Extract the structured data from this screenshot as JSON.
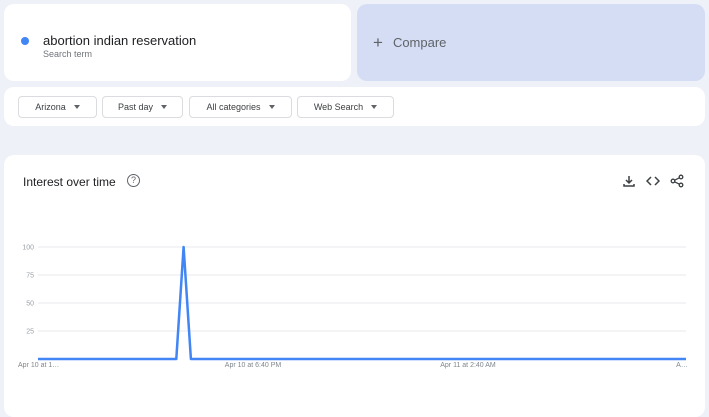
{
  "search_term": {
    "name": "abortion indian reservation",
    "subtitle": "Search term",
    "color": "#4285f4"
  },
  "compare": {
    "icon": "plus-icon",
    "label": "Compare"
  },
  "filters": [
    {
      "label": "Arizona"
    },
    {
      "label": "Past day"
    },
    {
      "label": "All categories"
    },
    {
      "label": "Web Search"
    }
  ],
  "card": {
    "title": "Interest over time",
    "help_icon": "?",
    "actions": [
      "download-icon",
      "embed-icon",
      "share-icon"
    ]
  },
  "chart_data": {
    "type": "line",
    "title": "Interest over time",
    "ylim": [
      0,
      100
    ],
    "yticks": [
      100,
      75,
      50,
      25
    ],
    "xtick_labels": [
      "Apr 10 at 1…",
      "Apr 10 at 6:40 PM",
      "Apr 11 at 2:40 AM",
      "A…"
    ],
    "series": [
      {
        "name": "abortion indian reservation",
        "color": "#4285f4",
        "values": [
          0,
          0,
          0,
          0,
          0,
          0,
          0,
          0,
          0,
          0,
          0,
          0,
          0,
          0,
          0,
          0,
          0,
          0,
          0,
          0,
          100,
          0,
          0,
          0,
          0,
          0,
          0,
          0,
          0,
          0,
          0,
          0,
          0,
          0,
          0,
          0,
          0,
          0,
          0,
          0,
          0,
          0,
          0,
          0,
          0,
          0,
          0,
          0,
          0,
          0,
          0,
          0,
          0,
          0,
          0,
          0,
          0,
          0,
          0,
          0,
          0,
          0,
          0,
          0,
          0,
          0,
          0,
          0,
          0,
          0,
          0,
          0,
          0,
          0,
          0,
          0,
          0,
          0,
          0,
          0,
          0,
          0,
          0,
          0,
          0,
          0,
          0,
          0,
          0,
          0
        ]
      }
    ]
  }
}
